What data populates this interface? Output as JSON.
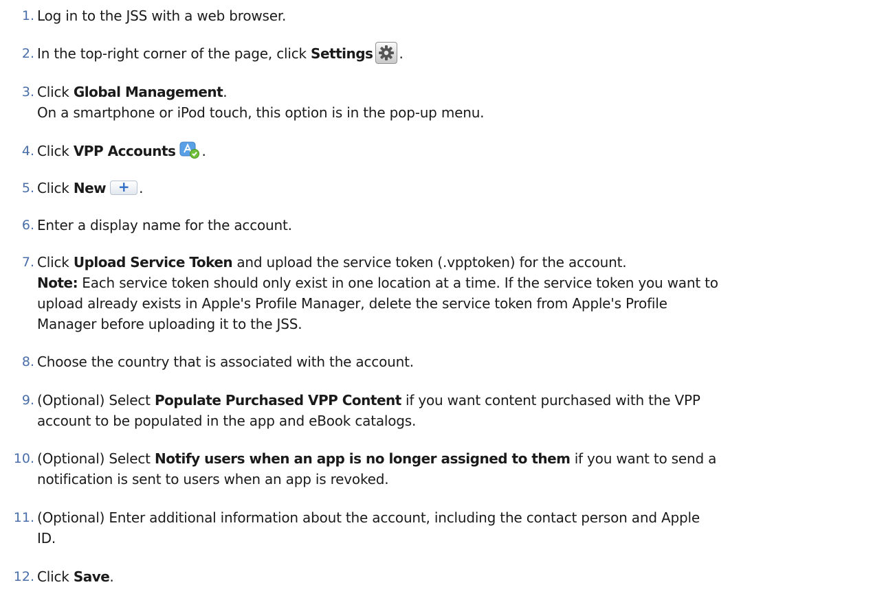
{
  "steps": [
    {
      "num": "1.",
      "lines": [
        [
          "Log in to the JSS with a web browser."
        ]
      ]
    },
    {
      "num": "2.",
      "pre": "In the top-right corner of the page, click ",
      "bold": "Settings",
      "icon": "gear-icon",
      "post": "."
    },
    {
      "num": "3.",
      "pre": "Click ",
      "bold": "Global Management",
      "post": ".",
      "extra": "On a smartphone or iPod touch, this option is in the pop-up menu."
    },
    {
      "num": "4.",
      "pre": "Click ",
      "bold": "VPP Accounts",
      "icon": "app-store-icon",
      "post": "."
    },
    {
      "num": "5.",
      "pre": "Click ",
      "bold": "New",
      "icon": "plus-icon",
      "icon_text": "+",
      "post": "."
    },
    {
      "num": "6.",
      "text": "Enter a display name for the account."
    },
    {
      "num": "7.",
      "pre": "Click ",
      "bold": "Upload Service Token",
      "post": " and upload the service token (.vpptoken) for the account.",
      "note_label": "Note:",
      "note_lines": [
        " Each service token should only exist in one location at a time. If the service token you want to",
        "upload already exists in Apple's Profile Manager, delete the service token from Apple's Profile",
        "Manager before uploading it to the JSS."
      ]
    },
    {
      "num": "8.",
      "text": "Choose the country that is associated with the account."
    },
    {
      "num": "9.",
      "pre": "(Optional) Select ",
      "bold": "Populate Purchased VPP Content",
      "post": " if you want content purchased with the VPP",
      "extra": "account to be populated in the app and eBook catalogs."
    },
    {
      "num": "10.",
      "pre": "(Optional) Select ",
      "bold": "Notify users when an app is no longer assigned to them",
      "post": " if you want to send a",
      "extra": "notification is sent to users when an app is revoked."
    },
    {
      "num": "11.",
      "text": "(Optional) Enter additional information about the account, including the contact person and Apple",
      "extra": "ID."
    },
    {
      "num": "12.",
      "pre": "Click ",
      "bold": "Save",
      "post": "."
    }
  ],
  "colors": {
    "number": "#4a6ea9",
    "text": "#1a1a1a"
  }
}
